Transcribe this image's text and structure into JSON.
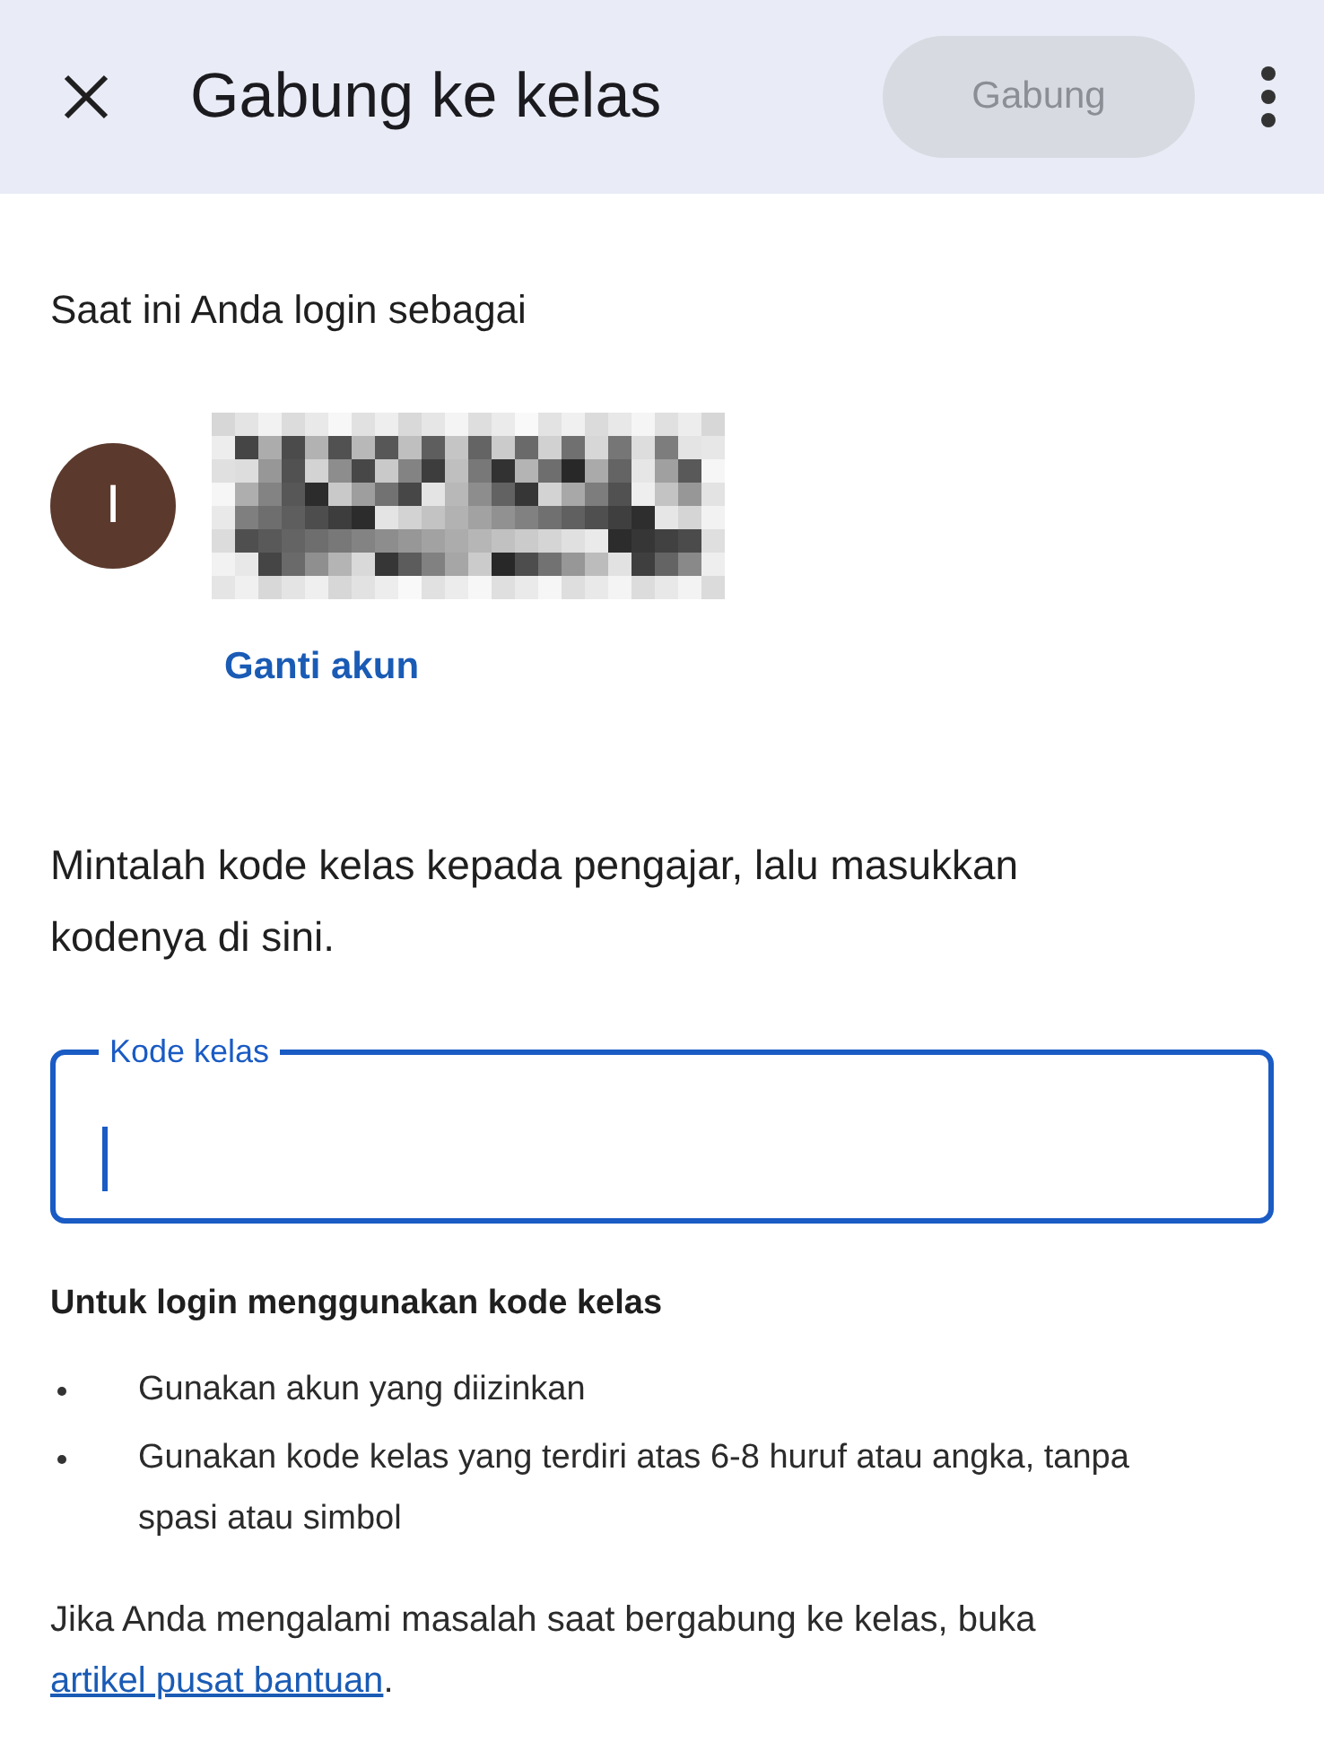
{
  "header": {
    "title": "Gabung ke kelas",
    "action": {
      "label": "Gabung",
      "disabled": true
    }
  },
  "account": {
    "heading": "Saat ini Anda login sebagai",
    "avatar_letter": "I",
    "switch_link": "Ganti akun"
  },
  "instruction": "Mintalah kode kelas kepada pengajar, lalu masukkan kodenya di sini.",
  "code_field": {
    "label": "Kode kelas",
    "focused": true
  },
  "tips": {
    "heading": "Untuk login menggunakan kode kelas",
    "bullets": [
      "Gunakan akun yang diizinkan",
      "Gunakan kode kelas yang terdiri atas 6-8 huruf atau angka, tanpa spasi atau simbol"
    ]
  },
  "help": {
    "text": "Jika Anda mengalami masalah saat bergabung ke kelas, buka ",
    "link": "artikel pusat bantuan",
    "after": "."
  }
}
